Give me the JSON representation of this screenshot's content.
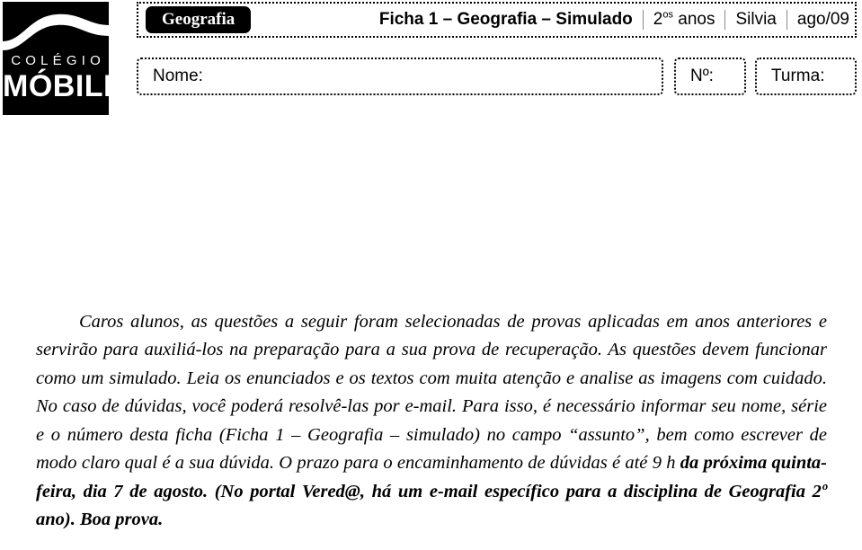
{
  "logo": {
    "line1": "COLÉGIO",
    "line2": "MÓBILE",
    "icon": "wave-swoosh"
  },
  "header": {
    "subject_tag": "Geografia",
    "title": "Ficha 1 – Geografia – Simulado",
    "grade": "2",
    "grade_sup": "os",
    "grade_suffix": " anos",
    "teacher": "Silvia",
    "date": "ago/09"
  },
  "identification": {
    "name_label": "Nome:",
    "name_value": "",
    "number_label": "Nº:",
    "number_value": "",
    "class_label": "Turma:",
    "class_value": ""
  },
  "body": {
    "part1": "Caros alunos, as questões a seguir foram selecionadas de provas aplicadas em anos anteriores e servirão para auxiliá-los na preparação para a sua prova de recuperação. As questões devem funcionar como um simulado. Leia os enunciados e os textos com muita atenção e analise as imagens com cuidado. No caso de dúvidas, você poderá resolvê-las por e-mail. Para isso, é necessário informar seu nome, série e o número desta ficha (Ficha 1 – Geografia – simulado) no campo “assunto”, bem como escrever de modo claro qual é a sua dúvida. O prazo para o encaminhamento de dúvidas é até 9 h ",
    "part2_bold": "da próxima quinta-feira, dia 7 de agosto. (No portal Vered@, há um e-mail específico para a disciplina de Geografia 2º ano). Boa prova."
  },
  "colors": {
    "ink": "#000000",
    "paper": "#ffffff",
    "separator": "#8a8a8a"
  }
}
